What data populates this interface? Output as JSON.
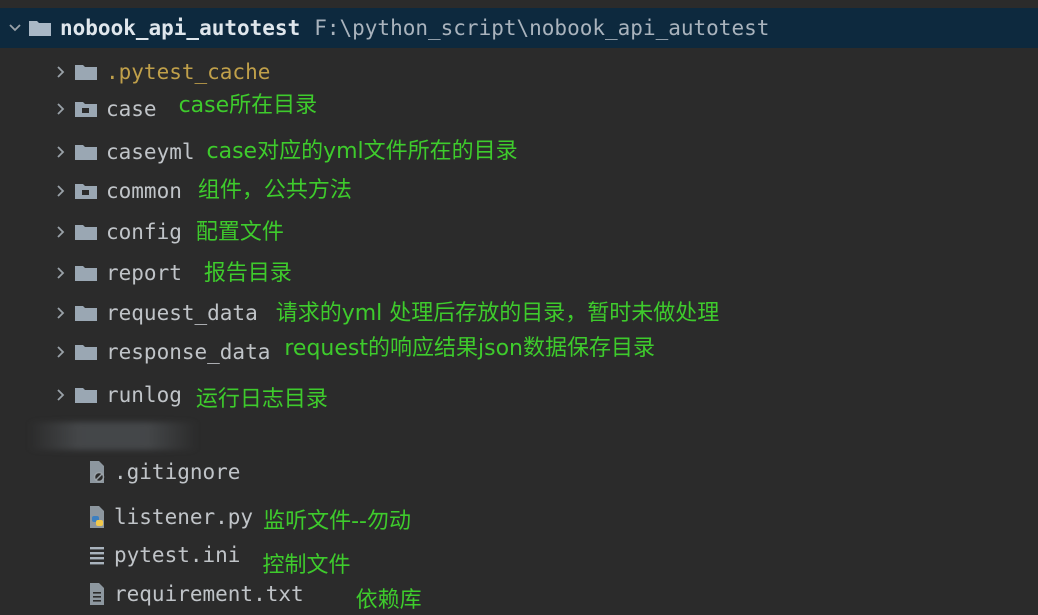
{
  "root": {
    "name": "nobook_api_autotest",
    "path": "F:\\python_script\\nobook_api_autotest"
  },
  "folders": [
    {
      "name": ".pytest_cache",
      "note": "",
      "icon": "folder-icon"
    },
    {
      "name": "case",
      "note": "case所在目录",
      "icon": "package-folder-icon"
    },
    {
      "name": "caseyml",
      "note": "case对应的yml文件所在的目录",
      "icon": "folder-icon"
    },
    {
      "name": "common",
      "note": "组件，公共方法",
      "icon": "package-folder-icon"
    },
    {
      "name": "config",
      "note": "配置文件",
      "icon": "folder-icon"
    },
    {
      "name": "report",
      "note": "报告目录",
      "icon": "folder-icon"
    },
    {
      "name": "request_data",
      "note": "请求的yml 处理后存放的目录，暂时未做处理",
      "icon": "folder-icon"
    },
    {
      "name": "response_data",
      "note": "request的响应结果json数据保存目录",
      "icon": "folder-icon"
    },
    {
      "name": "runlog",
      "note": "运行日志目录",
      "icon": "folder-icon"
    }
  ],
  "files": [
    {
      "name": ".gitignore",
      "note": "",
      "icon": "gitignore-file-icon"
    },
    {
      "name": "listener.py",
      "note": "监听文件--勿动",
      "icon": "python-file-icon"
    },
    {
      "name": "pytest.ini",
      "note": "控制文件",
      "icon": "ini-file-icon"
    },
    {
      "name": "requirement.txt",
      "note": "依赖库",
      "icon": "text-file-icon"
    }
  ],
  "colors": {
    "background": "#2b2b2b",
    "selected_row": "#0d293e",
    "annotation": "#3ecb2c",
    "excluded_folder": "#c0a04a"
  }
}
